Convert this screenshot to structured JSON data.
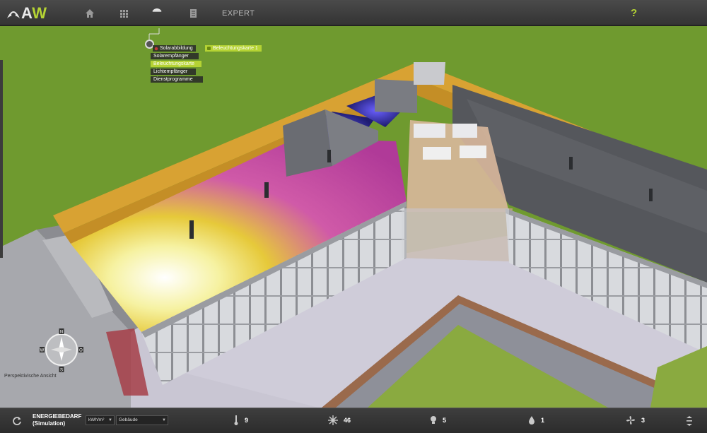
{
  "app": {
    "logo_a": "A",
    "logo_w": "W"
  },
  "topnav": {
    "expert_label": "EXPERT",
    "help_label": "?"
  },
  "menu": {
    "items": [
      {
        "label": "Solarabbildung"
      },
      {
        "label": "Solarempfänger"
      },
      {
        "label": "Beleuchtungskarte"
      },
      {
        "label": "Lichtempfänger"
      },
      {
        "label": "Dienstprogramme"
      }
    ],
    "submenu_label": "Beleuchtungskarte 1"
  },
  "compass": {
    "north": "N",
    "east": "O",
    "south": "S",
    "west": "W"
  },
  "viewport": {
    "view_label": "Perspektivische Ansicht"
  },
  "bottombar": {
    "title_line1": "ENERGIEBEDARF",
    "title_line2": "(Simulation)",
    "unit_select": "kWh/m²",
    "scope_select": "Gebäude",
    "stats": [
      {
        "icon": "thermometer-icon",
        "value": "9"
      },
      {
        "icon": "sun-icon",
        "value": "46"
      },
      {
        "icon": "lightbulb-icon",
        "value": "5"
      },
      {
        "icon": "water-drop-icon",
        "value": "1"
      },
      {
        "icon": "fan-icon",
        "value": "3"
      }
    ]
  },
  "colors": {
    "accent": "#b5d334",
    "bar": "#3a3a3a",
    "lawn": "#6f9a2f"
  }
}
